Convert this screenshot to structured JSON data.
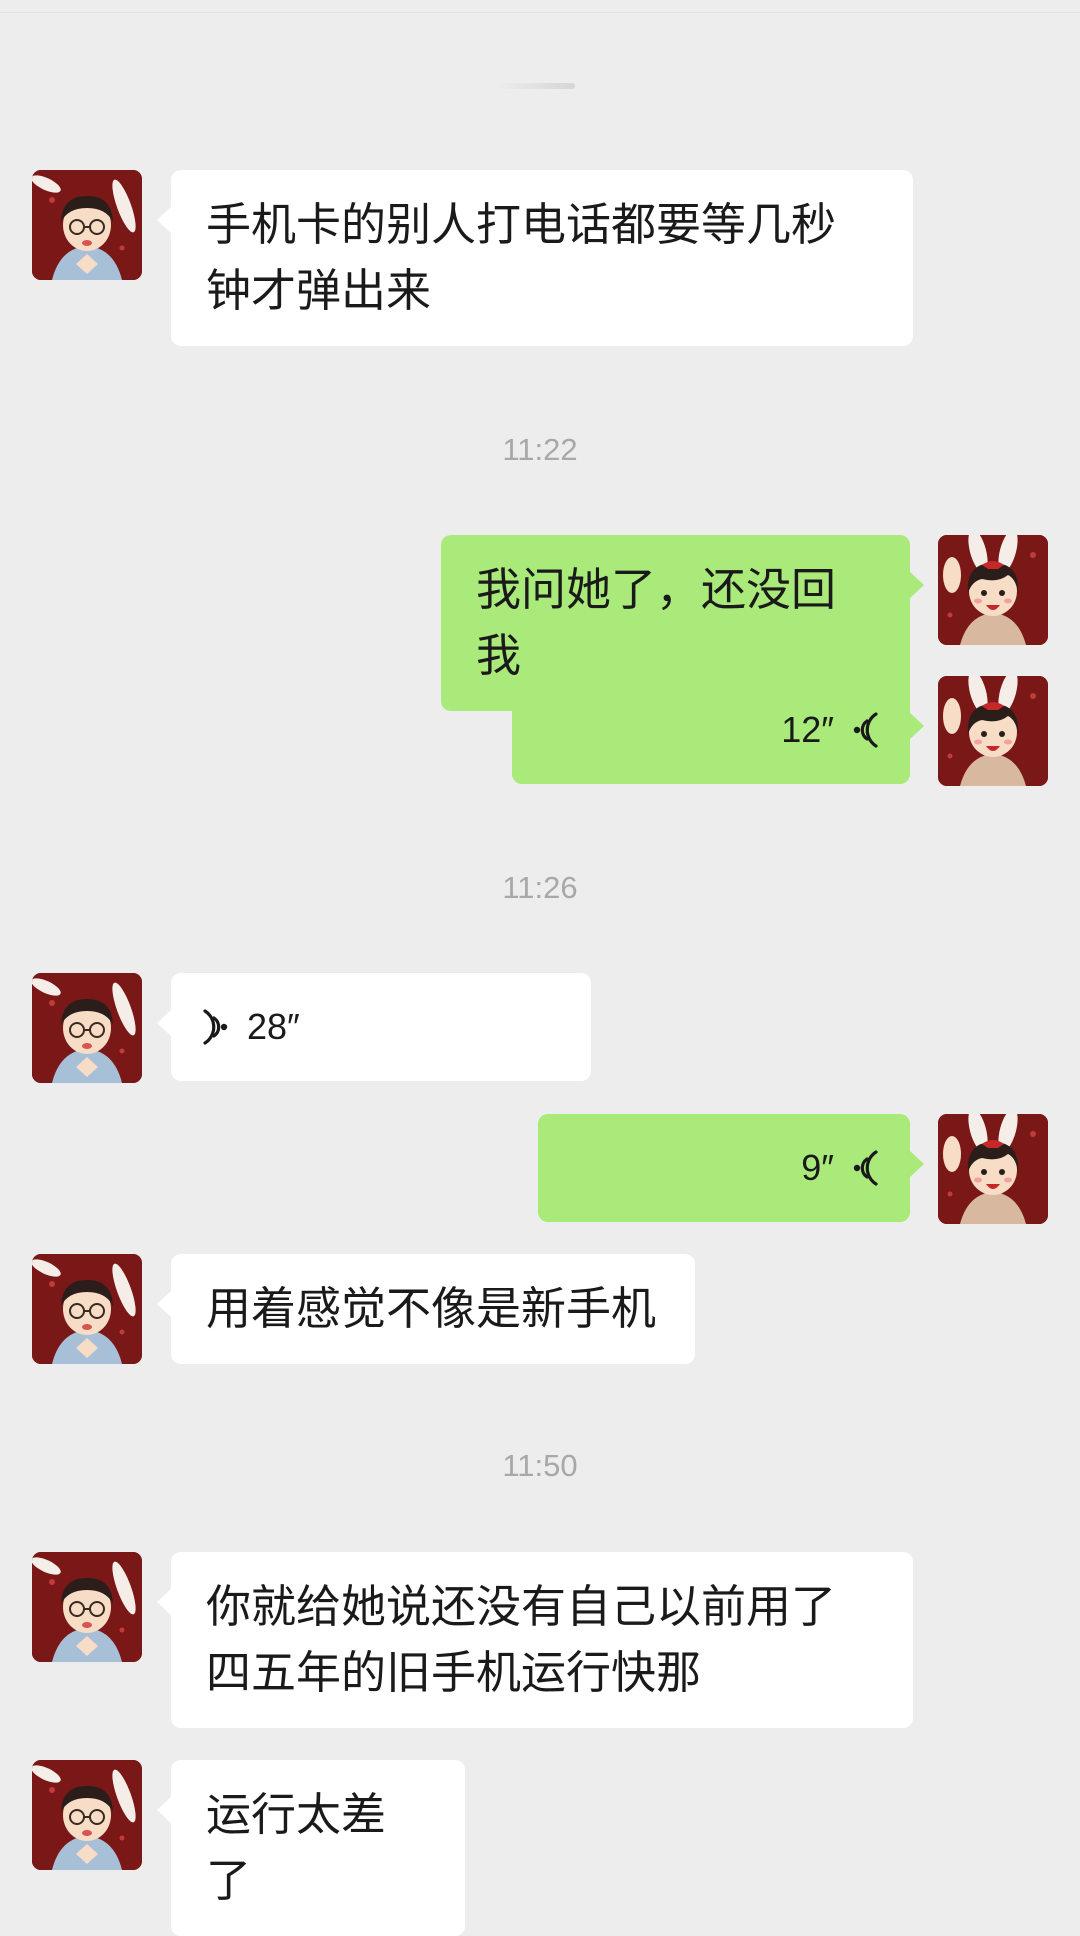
{
  "messages": [
    {
      "type": "text",
      "side": "in",
      "text": "手机卡的别人打电话都要等几秒钟才弹出来"
    },
    {
      "type": "time",
      "text": "11:22"
    },
    {
      "type": "text",
      "side": "out",
      "text": "我问她了，还没回我"
    },
    {
      "type": "voice",
      "side": "out",
      "duration": "12″"
    },
    {
      "type": "time",
      "text": "11:26"
    },
    {
      "type": "voice",
      "side": "in",
      "duration": "28″"
    },
    {
      "type": "voice",
      "side": "out",
      "duration": "9″"
    },
    {
      "type": "text",
      "side": "in",
      "text": "用着感觉不像是新手机"
    },
    {
      "type": "time",
      "text": "11:50"
    },
    {
      "type": "text",
      "side": "in",
      "text": "你就给她说还没有自己以前用了四五年的旧手机运行快那"
    },
    {
      "type": "text",
      "side": "in",
      "text": "运行太差了"
    }
  ],
  "colors": {
    "background": "#ededed",
    "incoming_bubble": "#ffffff",
    "outgoing_bubble": "#a9ea7a",
    "timestamp": "#a8a8a8",
    "avatar_background": "#7a1717"
  },
  "icons": {
    "contact_avatar": "boy-with-glasses-bunny-ears-avatar",
    "self_avatar": "girl-with-bunny-ears-avatar",
    "voice": "voice-waves-icon"
  }
}
